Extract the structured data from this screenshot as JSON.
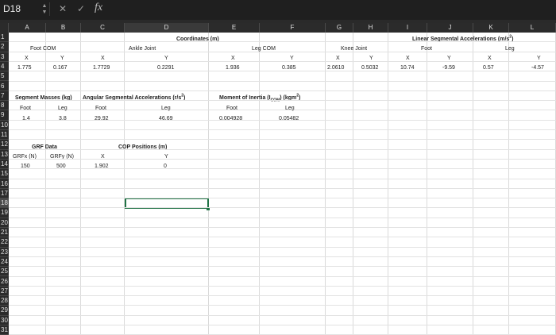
{
  "formula_bar": {
    "name_box": "D18",
    "fx_label": "fx",
    "formula": ""
  },
  "icons": {
    "name_box_stepper": "up-down-arrows-icon",
    "cancel": "cross-icon",
    "enter": "check-icon"
  },
  "columns": [
    "A",
    "B",
    "C",
    "D",
    "E",
    "F",
    "G",
    "H",
    "I",
    "J",
    "K",
    "L"
  ],
  "rows": [
    "1",
    "2",
    "3",
    "4",
    "5",
    "6",
    "7",
    "8",
    "9",
    "10",
    "11",
    "12",
    "13",
    "14",
    "15",
    "16",
    "17",
    "18",
    "19",
    "20",
    "21",
    "22",
    "23",
    "24",
    "25",
    "26",
    "27",
    "28",
    "29",
    "30",
    "31"
  ],
  "selected_cell": "D18",
  "colors": {
    "selection": "#217346",
    "header_bg": "#2b2b2b"
  },
  "sheet": {
    "coordinates_title": "Coordinates (m)",
    "foot_com": "Foot COM",
    "ankle_joint": "Ankle Joint",
    "leg_com": "Leg COM",
    "knee_joint": "Knee Joint",
    "lin_acc_title": "Linear Segmental Accelerations (m/s",
    "lin_acc_title_sup": "2",
    "lin_acc_title_end": ")",
    "lin_foot": "Foot",
    "lin_leg": "Leg",
    "x": "X",
    "y": "Y",
    "foot_com_x": "1.775",
    "foot_com_y": "0.167",
    "ankle_x": "1.7729",
    "ankle_y": "0.2291",
    "leg_com_x": "1.936",
    "leg_com_y": "0.385",
    "knee_x": "2.0610",
    "knee_y": "0.5032",
    "lin_foot_x": "10.74",
    "lin_foot_y": "-9.59",
    "lin_leg_x": "0.57",
    "lin_leg_y": "-4.57",
    "seg_mass_title": "Segment Masses (kg)",
    "ang_acc_title": "Angular Segmental Accelerations (r/s",
    "ang_acc_sup": "2",
    "ang_acc_end": ")",
    "moi_title": "Moment of Inertia (I",
    "moi_sub": "COM",
    "moi_mid": ") (kgm",
    "moi_sup": "2",
    "moi_end": ")",
    "foot": "Foot",
    "leg": "Leg",
    "mass_foot": "1.4",
    "mass_leg": "3.8",
    "ang_foot": "29.92",
    "ang_leg": "46.69",
    "moi_foot": "0.004928",
    "moi_leg": "0.05482",
    "grf_title": "GRF Data",
    "cop_title": "COP Positions (m)",
    "grfx_hdr": "GRFx (N)",
    "grfy_hdr": "GRFy (N)",
    "grfx": "150",
    "grfy": "500",
    "cop_x": "1.902",
    "cop_y": "0"
  }
}
